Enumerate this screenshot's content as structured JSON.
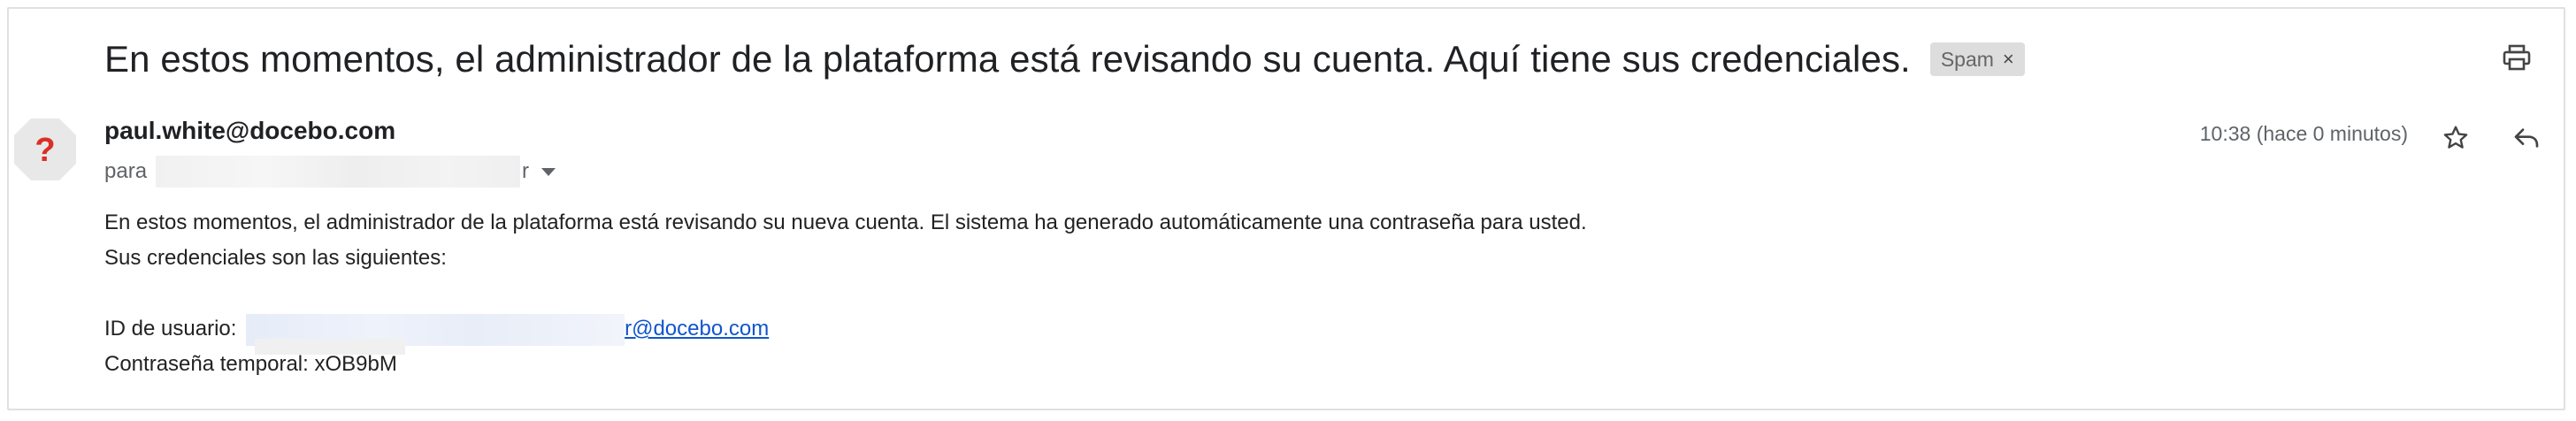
{
  "email": {
    "subject": "En estos momentos, el administrador de la plataforma está revisando su cuenta. Aquí tiene sus credenciales.",
    "label": "Spam",
    "label_remove": "×",
    "sender": "paul.white@docebo.com",
    "to_prefix": "para",
    "to_suffix": "r",
    "time": "10:38 (hace 0 minutos)",
    "avatar_symbol": "?",
    "body": {
      "line1": "En estos momentos, el administrador de la plataforma está revisando su nueva cuenta. El sistema ha generado automáticamente una contraseña para usted.",
      "line2": "Sus credenciales son las siguientes:",
      "user_id_label": "ID de usuario: ",
      "user_id_link": "r@docebo.com",
      "password_label": "Contraseña temporal: ",
      "password_value": "xOB9bM"
    }
  },
  "icons": {
    "print": "printer-icon",
    "star": "star-icon",
    "reply": "reply-icon",
    "avatar": "unknown-sender-icon"
  },
  "colors": {
    "avatar_bg": "#e8e8e8",
    "avatar_mark": "#d93025",
    "link": "#1155cc",
    "chip_bg": "#dddddd"
  }
}
